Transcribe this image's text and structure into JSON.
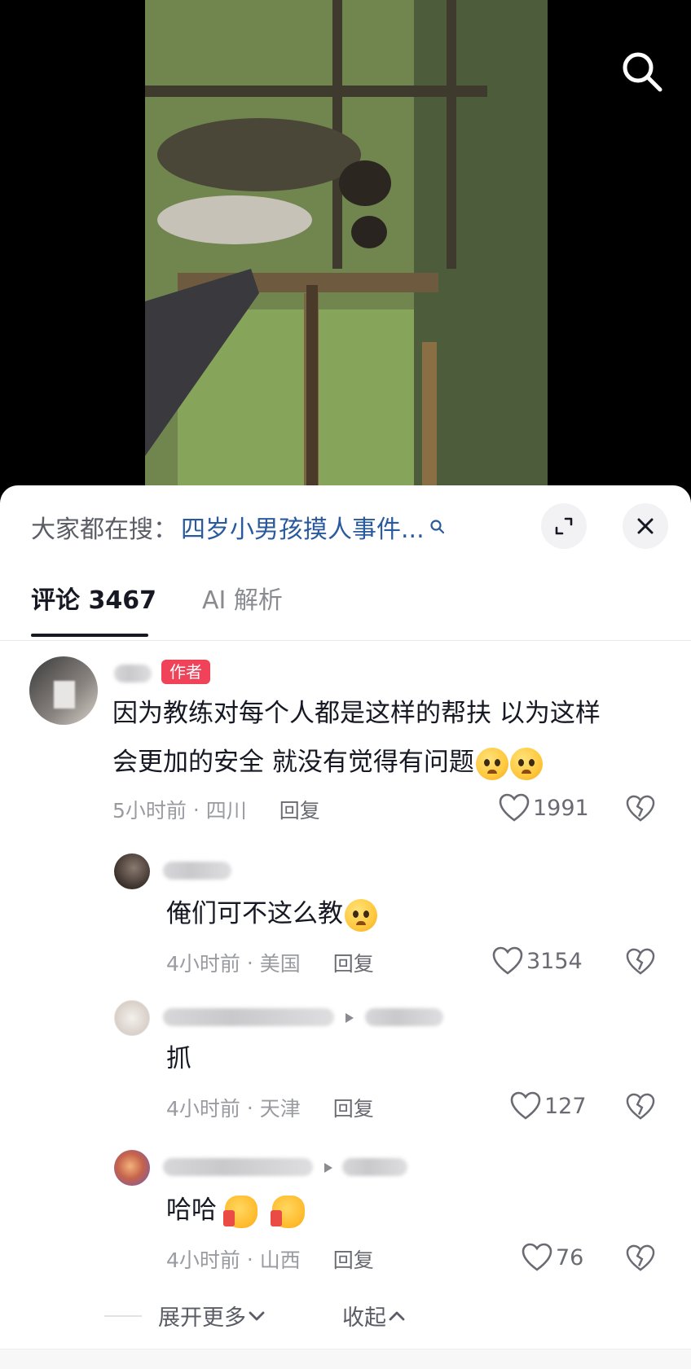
{
  "video": {
    "search_icon": "search-icon"
  },
  "sheet": {
    "trending": {
      "prefix": "大家都在搜：",
      "query": "四岁小男孩摸人事件...",
      "icon": "search-small-icon"
    },
    "expand_icon": "expand-icon",
    "close_icon": "close-icon",
    "tabs": [
      {
        "label": "评论 3467",
        "active": true
      },
      {
        "label": "AI 解析",
        "active": false
      }
    ]
  },
  "comments": [
    {
      "badge": "作者",
      "text_line1": "因为教练对每个人都是这样的帮扶 以为这样",
      "text_line2": "会更加的安全 就没有觉得有问题",
      "emojis": [
        "pleading-emoji",
        "pleading-emoji"
      ],
      "time": "5小时前",
      "location": "四川",
      "reply_label": "回复",
      "likes": "1991"
    }
  ],
  "replies": [
    {
      "text": "俺们可不这么教",
      "emojis": [
        "crying-emoji"
      ],
      "time": "4小时前",
      "location": "美国",
      "reply_label": "回复",
      "likes": "3154"
    },
    {
      "text": "抓",
      "emojis": [],
      "time": "4小时前",
      "location": "天津",
      "reply_label": "回复",
      "likes": "127"
    },
    {
      "text": "哈哈",
      "emojis": [
        "thumbs-up-emoji",
        "thumbs-up-emoji"
      ],
      "time": "4小时前",
      "location": "山西",
      "reply_label": "回复",
      "likes": "76"
    }
  ],
  "footer": {
    "expand_more": "展开更多",
    "collapse": "收起"
  },
  "colors": {
    "badge": "#f0435a",
    "link": "#2a5a9e",
    "text": "#161823",
    "muted": "#9a9ba1"
  }
}
